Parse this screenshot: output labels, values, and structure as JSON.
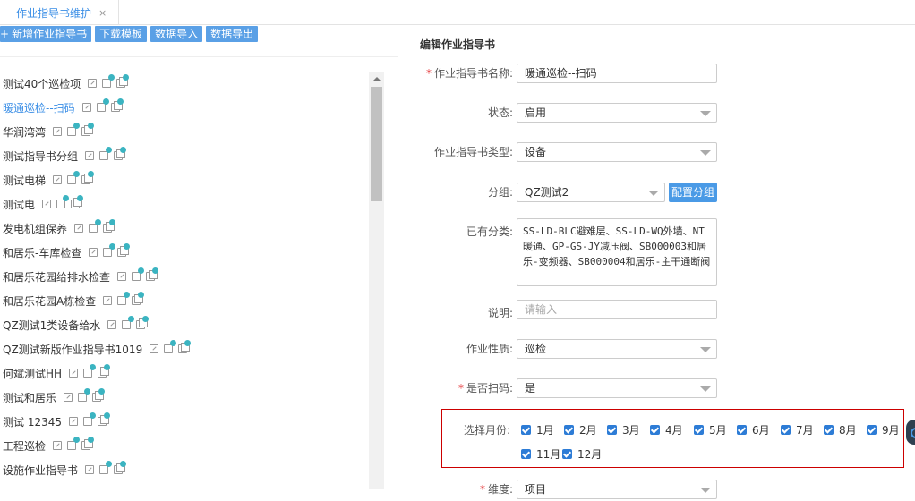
{
  "tab": {
    "label": "作业指导书维护",
    "close": "×"
  },
  "toolbar": {
    "add_icon": "+",
    "add": "新增作业指导书",
    "download": "下载模板",
    "import": "数据导入",
    "export": "数据导出"
  },
  "tree": {
    "items": [
      {
        "label": "测试40个巡检项",
        "y": 0
      },
      {
        "label": "暖通巡检--扫码",
        "active": true
      },
      {
        "label": "华润湾湾"
      },
      {
        "label": "测试指导书分组"
      },
      {
        "label": "测试电梯"
      },
      {
        "label": "测试电"
      },
      {
        "label": "发电机组保养"
      },
      {
        "label": "和居乐-车库检查"
      },
      {
        "label": "和居乐花园给排水检查"
      },
      {
        "label": "和居乐花园A栋检查"
      },
      {
        "label": "QZ测试1类设备给水"
      },
      {
        "label": "QZ测试新版作业指导书1019"
      },
      {
        "label": "何斌测试HH"
      },
      {
        "label": "测试和居乐"
      },
      {
        "label": "测试 12345"
      },
      {
        "label": "工程巡检"
      },
      {
        "label": "设施作业指导书"
      }
    ]
  },
  "form": {
    "title": "编辑作业指导书",
    "name": {
      "label": "作业指导书名称:",
      "value": "暖通巡检--扫码",
      "required": "*"
    },
    "status": {
      "label": "状态:",
      "value": "启用"
    },
    "type": {
      "label": "作业指导书类型:",
      "value": "设备"
    },
    "group": {
      "label": "分组:",
      "value": "QZ测试2",
      "config_button": "配置分组"
    },
    "categories": {
      "label": "已有分类:",
      "value": "SS-LD-BLC避难层、SS-LD-WQ外墙、NT暖通、GP-GS-JY减压阀、SB000003和居乐-变频器、SB000004和居乐-主干通断阀"
    },
    "description": {
      "label": "说明:",
      "placeholder": "请输入"
    },
    "nature": {
      "label": "作业性质:",
      "value": "巡检"
    },
    "scan": {
      "label": "是否扫码:",
      "value": "是",
      "required": "*"
    },
    "months": {
      "label": "选择月份:",
      "options": [
        "1月",
        "2月",
        "3月",
        "4月",
        "5月",
        "6月",
        "7月",
        "8月",
        "9月",
        "11月",
        "12月"
      ],
      "checked": [
        true,
        true,
        true,
        true,
        true,
        true,
        true,
        true,
        true,
        true,
        true
      ]
    },
    "cutoff": {
      "label": "维度:",
      "value": "项目",
      "required": "*"
    }
  }
}
